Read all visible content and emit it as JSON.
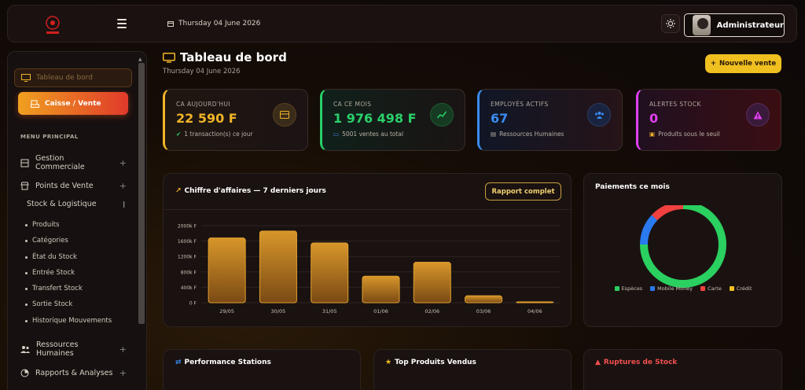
{
  "header": {
    "date": "Thursday 04 June 2026",
    "user_name": "Administrateur"
  },
  "sidebar": {
    "dashboard_label": "Tableau de bord",
    "caisse_label": "Caisse / Vente",
    "menu_title": "MENU PRINCIPAL",
    "items": [
      {
        "label": "Gestion\nCommerciale",
        "icon": "register-icon"
      },
      {
        "label": "Points de Vente",
        "icon": "store-icon"
      },
      {
        "label": "Stock & Logistique",
        "icon": ""
      },
      {
        "label": "Ressources\nHumaines",
        "icon": "people-icon"
      },
      {
        "label": "Rapports & Analyses",
        "icon": "chart-icon"
      }
    ],
    "stock_subitems": [
      "Produits",
      "Catégories",
      "État du Stock",
      "Entrée Stock",
      "Transfert Stock",
      "Sortie Stock",
      "Historique Mouvements"
    ]
  },
  "page": {
    "title": "Tableau de bord",
    "date": "Thursday 04 June 2026",
    "new_sale_label": "Nouvelle vente"
  },
  "kpis": [
    {
      "label": "CA AUJOURD'HUI",
      "value": "22 590 F",
      "sub": "1 transaction(s) ce jour",
      "color": "#f0b428",
      "icon": "wallet-icon"
    },
    {
      "label": "CA CE MOIS",
      "value": "1 976 498 F",
      "sub": "5001 ventes au total",
      "color": "#2ad06a",
      "icon": "trend-icon"
    },
    {
      "label": "EMPLOYÉS ACTIFS",
      "value": "67",
      "sub": "Ressources Humaines",
      "color": "#3a8cf0",
      "icon": "team-icon"
    },
    {
      "label": "ALERTES STOCK",
      "value": "0",
      "sub": "Produits sous le seuil",
      "color": "#e040f0",
      "icon": "warning-icon"
    }
  ],
  "revenue_panel": {
    "title": "Chiffre d'affaires — 7 derniers jours",
    "report_label": "Rapport complet"
  },
  "chart_data": [
    {
      "type": "bar",
      "title": "Chiffre d'affaires — 7 derniers jours",
      "categories": [
        "29/05",
        "30/05",
        "31/05",
        "01/06",
        "02/06",
        "03/06",
        "04/06"
      ],
      "values": [
        1680000,
        1860000,
        1550000,
        690000,
        1050000,
        180000,
        22590
      ],
      "ylim": [
        0,
        2000000
      ],
      "yticks": [
        "0 F",
        "400k F",
        "800k F",
        "1200k F",
        "1600k F",
        "2000k F"
      ],
      "grid": true
    },
    {
      "type": "pie",
      "title": "Paiements ce mois",
      "categories": [
        "Espèces",
        "Mobile Money",
        "Carte",
        "Crédit"
      ],
      "values": [
        75,
        12,
        13,
        0
      ],
      "colors": [
        "#2ad060",
        "#2a7af0",
        "#f04040",
        "#f0c020"
      ],
      "legend": "bottom"
    }
  ],
  "payments_panel": {
    "title": "Paiements ce mois"
  },
  "bottom_panels": [
    {
      "title": "Performance Stations",
      "color": "#ffffff",
      "icon": "trend-icon"
    },
    {
      "title": "Top Produits Vendus",
      "color": "#ffffff",
      "icon": "star-icon"
    },
    {
      "title": "Ruptures de Stock",
      "color": "#f05050",
      "icon": "warning-icon"
    }
  ]
}
